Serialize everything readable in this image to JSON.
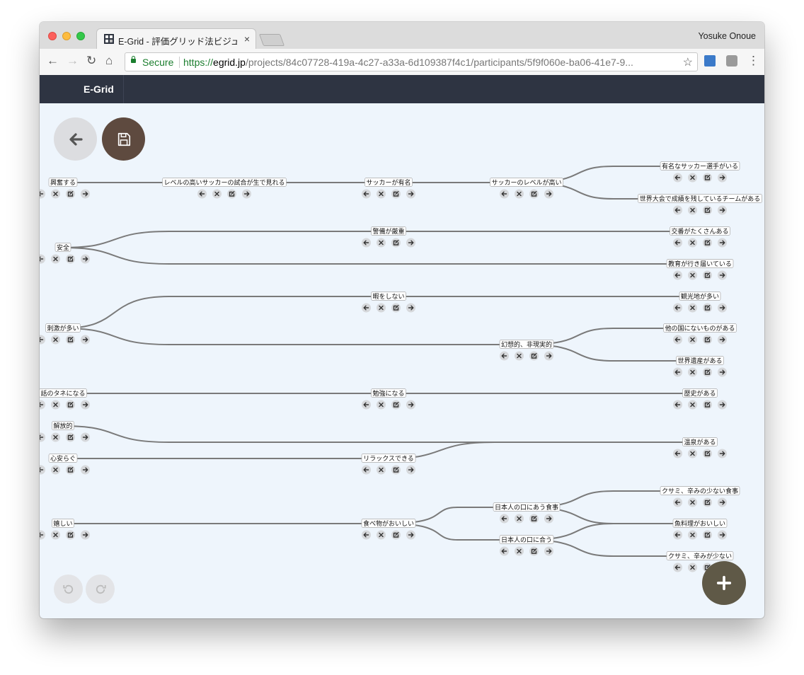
{
  "browser": {
    "tab_title": "E-Grid - 評価グリッド法ビジュ",
    "tab_close": "×",
    "user_name": "Yosuke Onoue",
    "secure_label": "Secure",
    "url_scheme": "https://",
    "url_host": "egrid.jp",
    "url_path": "/projects/84c07728-419a-4c27-a33a-6d109387f4c1/participants/5f9f060e-ba06-41e7-9...",
    "back_icon": "←",
    "forward_icon": "→",
    "reload_icon": "↻",
    "home_icon": "⌂",
    "star_icon": "☆",
    "menu_icon": "⋮"
  },
  "app": {
    "brand": "E-Grid"
  },
  "colors": {
    "appbar": "#2e3442",
    "canvas": "#eef5fc",
    "save_button": "#5e4a3f",
    "add_button": "#5f5947",
    "edge": "#7a7a7a"
  },
  "graph": {
    "nodes": [
      {
        "id": "n1",
        "label": "興奮する"
      },
      {
        "id": "n2",
        "label": "レベルの高いサッカーの試合が生で見れる"
      },
      {
        "id": "n3",
        "label": "サッカーが有名"
      },
      {
        "id": "n4",
        "label": "サッカーのレベルが高い"
      },
      {
        "id": "n5",
        "label": "有名なサッカー選手がいる"
      },
      {
        "id": "n6",
        "label": "世界大会で成績を残しているチームがある"
      },
      {
        "id": "n7",
        "label": "安全"
      },
      {
        "id": "n8",
        "label": "警備が厳重"
      },
      {
        "id": "n9",
        "label": "交番がたくさんある"
      },
      {
        "id": "n10",
        "label": "教育が行き届いている"
      },
      {
        "id": "n11",
        "label": "刺激が多い"
      },
      {
        "id": "n12",
        "label": "暇をしない"
      },
      {
        "id": "n13",
        "label": "観光地が多い"
      },
      {
        "id": "n14",
        "label": "幻想的、非現実的"
      },
      {
        "id": "n15",
        "label": "他の国にないものがある"
      },
      {
        "id": "n16",
        "label": "世界遺産がある"
      },
      {
        "id": "n17",
        "label": "話のタネになる"
      },
      {
        "id": "n18",
        "label": "勉強になる"
      },
      {
        "id": "n19",
        "label": "歴史がある"
      },
      {
        "id": "n20",
        "label": "解放的"
      },
      {
        "id": "n21",
        "label": "心安らぐ"
      },
      {
        "id": "n22",
        "label": "リラックスできる"
      },
      {
        "id": "n23",
        "label": "温泉がある"
      },
      {
        "id": "n24",
        "label": "嬉しい"
      },
      {
        "id": "n25",
        "label": "食べ物がおいしい"
      },
      {
        "id": "n26",
        "label": "日本人の口にあう食事"
      },
      {
        "id": "n27",
        "label": "日本人の口に合う"
      },
      {
        "id": "n28",
        "label": "クサミ、辛みの少ない食事"
      },
      {
        "id": "n29",
        "label": "魚料理がおいしい"
      },
      {
        "id": "n30",
        "label": "クサミ、辛みが少ない"
      }
    ],
    "edges": [
      [
        "n1",
        "n2"
      ],
      [
        "n2",
        "n3"
      ],
      [
        "n3",
        "n4"
      ],
      [
        "n4",
        "n5"
      ],
      [
        "n4",
        "n6"
      ],
      [
        "n7",
        "n8"
      ],
      [
        "n8",
        "n9"
      ],
      [
        "n7",
        "n10"
      ],
      [
        "n11",
        "n12"
      ],
      [
        "n12",
        "n13"
      ],
      [
        "n11",
        "n14"
      ],
      [
        "n14",
        "n15"
      ],
      [
        "n14",
        "n16"
      ],
      [
        "n17",
        "n18"
      ],
      [
        "n18",
        "n19"
      ],
      [
        "n20",
        "n23"
      ],
      [
        "n21",
        "n22"
      ],
      [
        "n22",
        "n23"
      ],
      [
        "n24",
        "n25"
      ],
      [
        "n25",
        "n26"
      ],
      [
        "n25",
        "n27"
      ],
      [
        "n26",
        "n28"
      ],
      [
        "n26",
        "n29"
      ],
      [
        "n27",
        "n29"
      ],
      [
        "n27",
        "n30"
      ]
    ],
    "node_action_icons": [
      "arrow-left-icon",
      "close-icon",
      "edit-icon",
      "arrow-right-icon"
    ]
  },
  "buttons": {
    "back_icon": "arrow-left-icon",
    "save_icon": "floppy-disk-icon",
    "undo_icon": "undo-icon",
    "redo_icon": "redo-icon",
    "add_icon": "plus-icon"
  }
}
